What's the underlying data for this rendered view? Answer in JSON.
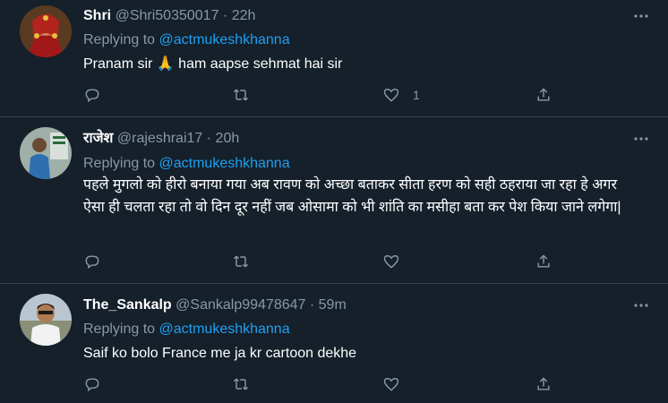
{
  "tweets": [
    {
      "name": "Shri",
      "handle": "@Shri50350017",
      "time": "22h",
      "replying_label": "Replying to",
      "replying_to": "@actmukeshkhanna",
      "text": "Pranam sir 🙏 ham aapse sehmat hai sir",
      "like_count": "1",
      "avatar_icon": "woman-bridal-avatar"
    },
    {
      "name": "राजेश",
      "handle": "@rajeshrai17",
      "time": "20h",
      "replying_label": "Replying to",
      "replying_to": "@actmukeshkhanna",
      "text": "पहले मुगलो को हीरो बनाया गया अब रावण को अच्छा बताकर सीता हरण को सही ठहराया जा रहा हे अगर ऐसा ही चलता रहा तो वो दिन दूर नहीं जब  ओसामा को भी शांति का मसीहा बता कर पेश किया जाने लगेगा|",
      "like_count": "",
      "avatar_icon": "man-avatar"
    },
    {
      "name": "The_Sankalp",
      "handle": "@Sankalp99478647",
      "time": "59m",
      "replying_label": "Replying to",
      "replying_to": "@actmukeshkhanna",
      "text": "Saif ko bolo France me ja kr cartoon dekhe",
      "like_count": "",
      "avatar_icon": "man-avatar"
    }
  ],
  "separator": "·",
  "icons": {
    "reply": "reply-icon",
    "retweet": "retweet-icon",
    "like": "heart-icon",
    "share": "share-icon",
    "more": "more-icon"
  },
  "colors": {
    "background": "#15202b",
    "border": "#38444d",
    "secondary_text": "#8899a6",
    "link": "#1da1f2"
  }
}
